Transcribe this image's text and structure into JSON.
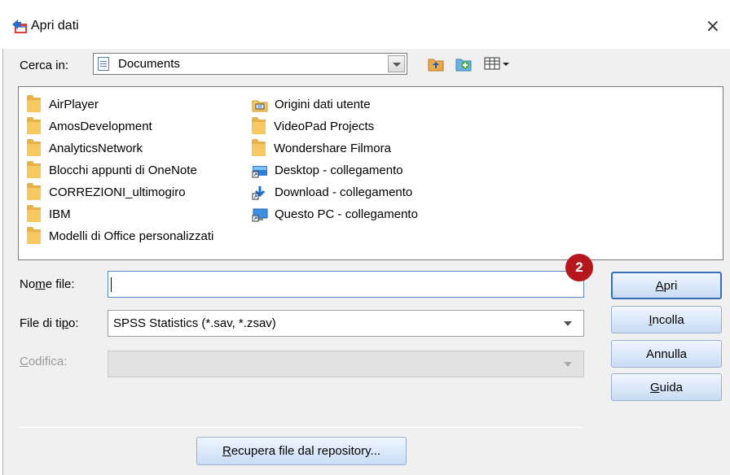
{
  "window": {
    "title": "Apri dati",
    "close_glyph": "×",
    "app_icon": "spss-open-data-icon"
  },
  "lookin": {
    "label": "Cerca in:",
    "value": "Documents",
    "toolbar": [
      "folder-up-icon",
      "new-folder-icon",
      "view-menu-icon"
    ]
  },
  "files": {
    "col1": [
      {
        "name": "AirPlayer",
        "icon": "folder-icon"
      },
      {
        "name": "AmosDevelopment",
        "icon": "folder-icon"
      },
      {
        "name": "AnalyticsNetwork",
        "icon": "folder-icon"
      },
      {
        "name": "Blocchi appunti di OneNote",
        "icon": "folder-icon"
      },
      {
        "name": "CORREZIONI_ultimogiro",
        "icon": "folder-icon"
      },
      {
        "name": "IBM",
        "icon": "folder-icon"
      },
      {
        "name": "Modelli di Office personalizzati",
        "icon": "folder-icon"
      }
    ],
    "col2": [
      {
        "name": "Origini dati utente",
        "icon": "datasource-folder-icon"
      },
      {
        "name": "VideoPad Projects",
        "icon": "folder-icon"
      },
      {
        "name": "Wondershare Filmora",
        "icon": "folder-icon"
      },
      {
        "name": "Desktop - collegamento",
        "icon": "desktop-shortcut-icon"
      },
      {
        "name": "Download - collegamento",
        "icon": "download-shortcut-icon"
      },
      {
        "name": "Questo PC - collegamento",
        "icon": "pc-shortcut-icon"
      }
    ]
  },
  "form": {
    "filename_label_pre": "No",
    "filename_label_u": "m",
    "filename_label_post": "e file:",
    "filename_value": "",
    "filetype_label_pre": "File di ti",
    "filetype_label_u": "p",
    "filetype_label_post": "o:",
    "filetype_value": "SPSS Statistics (*.sav, *.zsav)",
    "encoding_label_u": "C",
    "encoding_label_post": "odifica:",
    "encoding_value": ""
  },
  "badge": "2",
  "buttons": {
    "open_u": "A",
    "open_rest": "pri",
    "paste_u": "I",
    "paste_rest": "ncolla",
    "cancel": "Annulla",
    "help_u": "G",
    "help_rest": "uida",
    "repo_u": "R",
    "repo_rest": "ecupera file dal repository..."
  },
  "colors": {
    "accent": "#3a6fb8",
    "badge": "#b4181d",
    "folder": "#f6c85f"
  }
}
